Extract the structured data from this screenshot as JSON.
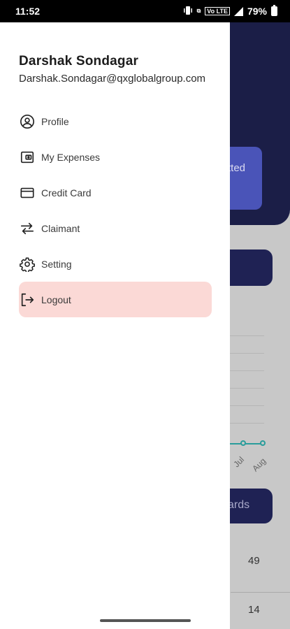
{
  "status_bar": {
    "time": "11:52",
    "network_info": "Vo LTE",
    "battery": "79%"
  },
  "drawer": {
    "user": {
      "name": "Darshak Sondagar",
      "email": "Darshak.Sondagar@qxglobalgroup.com"
    },
    "menu": [
      {
        "label": "Profile",
        "icon": "account-circle-icon"
      },
      {
        "label": "My Expenses",
        "icon": "wallet-icon"
      },
      {
        "label": "Credit Card",
        "icon": "credit-card-icon"
      },
      {
        "label": "Claimant",
        "icon": "swap-arrows-icon"
      },
      {
        "label": "Setting",
        "icon": "gear-icon"
      },
      {
        "label": "Logout",
        "icon": "logout-icon",
        "active": true
      }
    ]
  },
  "background": {
    "card_text": "tted",
    "chart_ticks": [
      "Jul",
      "Aug"
    ],
    "button_text": "ards",
    "numbers": [
      "49",
      "14"
    ]
  },
  "colors": {
    "drawer_bg": "#ffffff",
    "active_item_bg": "#fbd9d6",
    "header_navy": "#1b1e47",
    "card_blue": "#4a54b8",
    "chart_teal": "#2a9d9b"
  }
}
